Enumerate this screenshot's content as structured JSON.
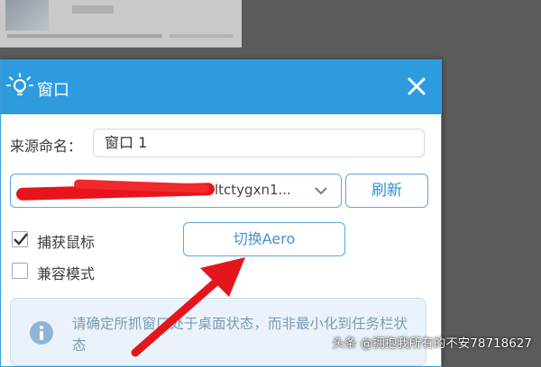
{
  "dialog": {
    "title": "窗口",
    "icon": "lightbulb-icon",
    "close_icon": "close-icon"
  },
  "form": {
    "source_name_label": "来源命名：",
    "source_name_value": "窗口 1",
    "window_select_text": "ltctygxn1...",
    "refresh_label": "刷新",
    "capture_mouse_label": "捕获鼠标",
    "capture_mouse_checked": true,
    "compat_mode_label": "兼容模式",
    "compat_mode_checked": false,
    "aero_button_label": "切换Aero"
  },
  "info": {
    "icon": "info-icon",
    "text": "请确定所抓窗口处于桌面状态，而非最小化到任务栏状态"
  },
  "watermark": "头条 @拥抱我所有的不安78718627",
  "colors": {
    "titlebar": "#2e9bdf",
    "accent": "#2a8fd6",
    "annotation_arrow": "#e3161e",
    "redaction": "#e8131c"
  }
}
